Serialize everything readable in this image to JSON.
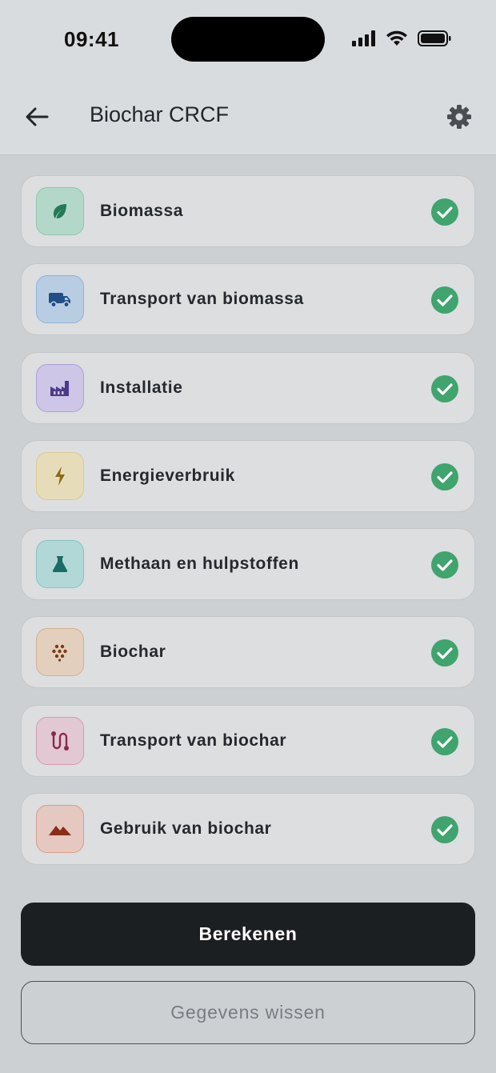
{
  "status_bar": {
    "time": "09:41"
  },
  "header": {
    "title": "Biochar CRCF"
  },
  "items": [
    {
      "label": "Biomassa",
      "icon": "leaf-icon",
      "bg": "#b3d8c9",
      "border": "#8cc7aa",
      "fg": "#257a55",
      "completed": true
    },
    {
      "label": "Transport van biomassa",
      "icon": "truck-icon",
      "bg": "#b9cde2",
      "border": "#8fb2d9",
      "fg": "#1f4f86",
      "completed": true
    },
    {
      "label": "Installatie",
      "icon": "factory-icon",
      "bg": "#cdc6e6",
      "border": "#aea0da",
      "fg": "#4c3a8a",
      "completed": true
    },
    {
      "label": "Energieverbruik",
      "icon": "lightning-icon",
      "bg": "#e6dcb9",
      "border": "#dcc88a",
      "fg": "#8a6a10",
      "completed": true
    },
    {
      "label": "Methaan en hulpstoffen",
      "icon": "flask-icon",
      "bg": "#b1d8d6",
      "border": "#86c4c0",
      "fg": "#1d6b66",
      "completed": true
    },
    {
      "label": "Biochar",
      "icon": "granules-icon",
      "bg": "#e3cfbe",
      "border": "#d9ad8a",
      "fg": "#7a3b14",
      "completed": true
    },
    {
      "label": "Transport van biochar",
      "icon": "route-icon",
      "bg": "#e2c8d2",
      "border": "#d49bb1",
      "fg": "#8a2a4d",
      "completed": true
    },
    {
      "label": "Gebruik van biochar",
      "icon": "mountain-icon",
      "bg": "#e5c8bf",
      "border": "#dc9c87",
      "fg": "#8a2e18",
      "completed": true
    }
  ],
  "actions": {
    "primary_label": "Berekenen",
    "secondary_label": "Gegevens wissen"
  },
  "colors": {
    "check": "#3fa46e"
  }
}
